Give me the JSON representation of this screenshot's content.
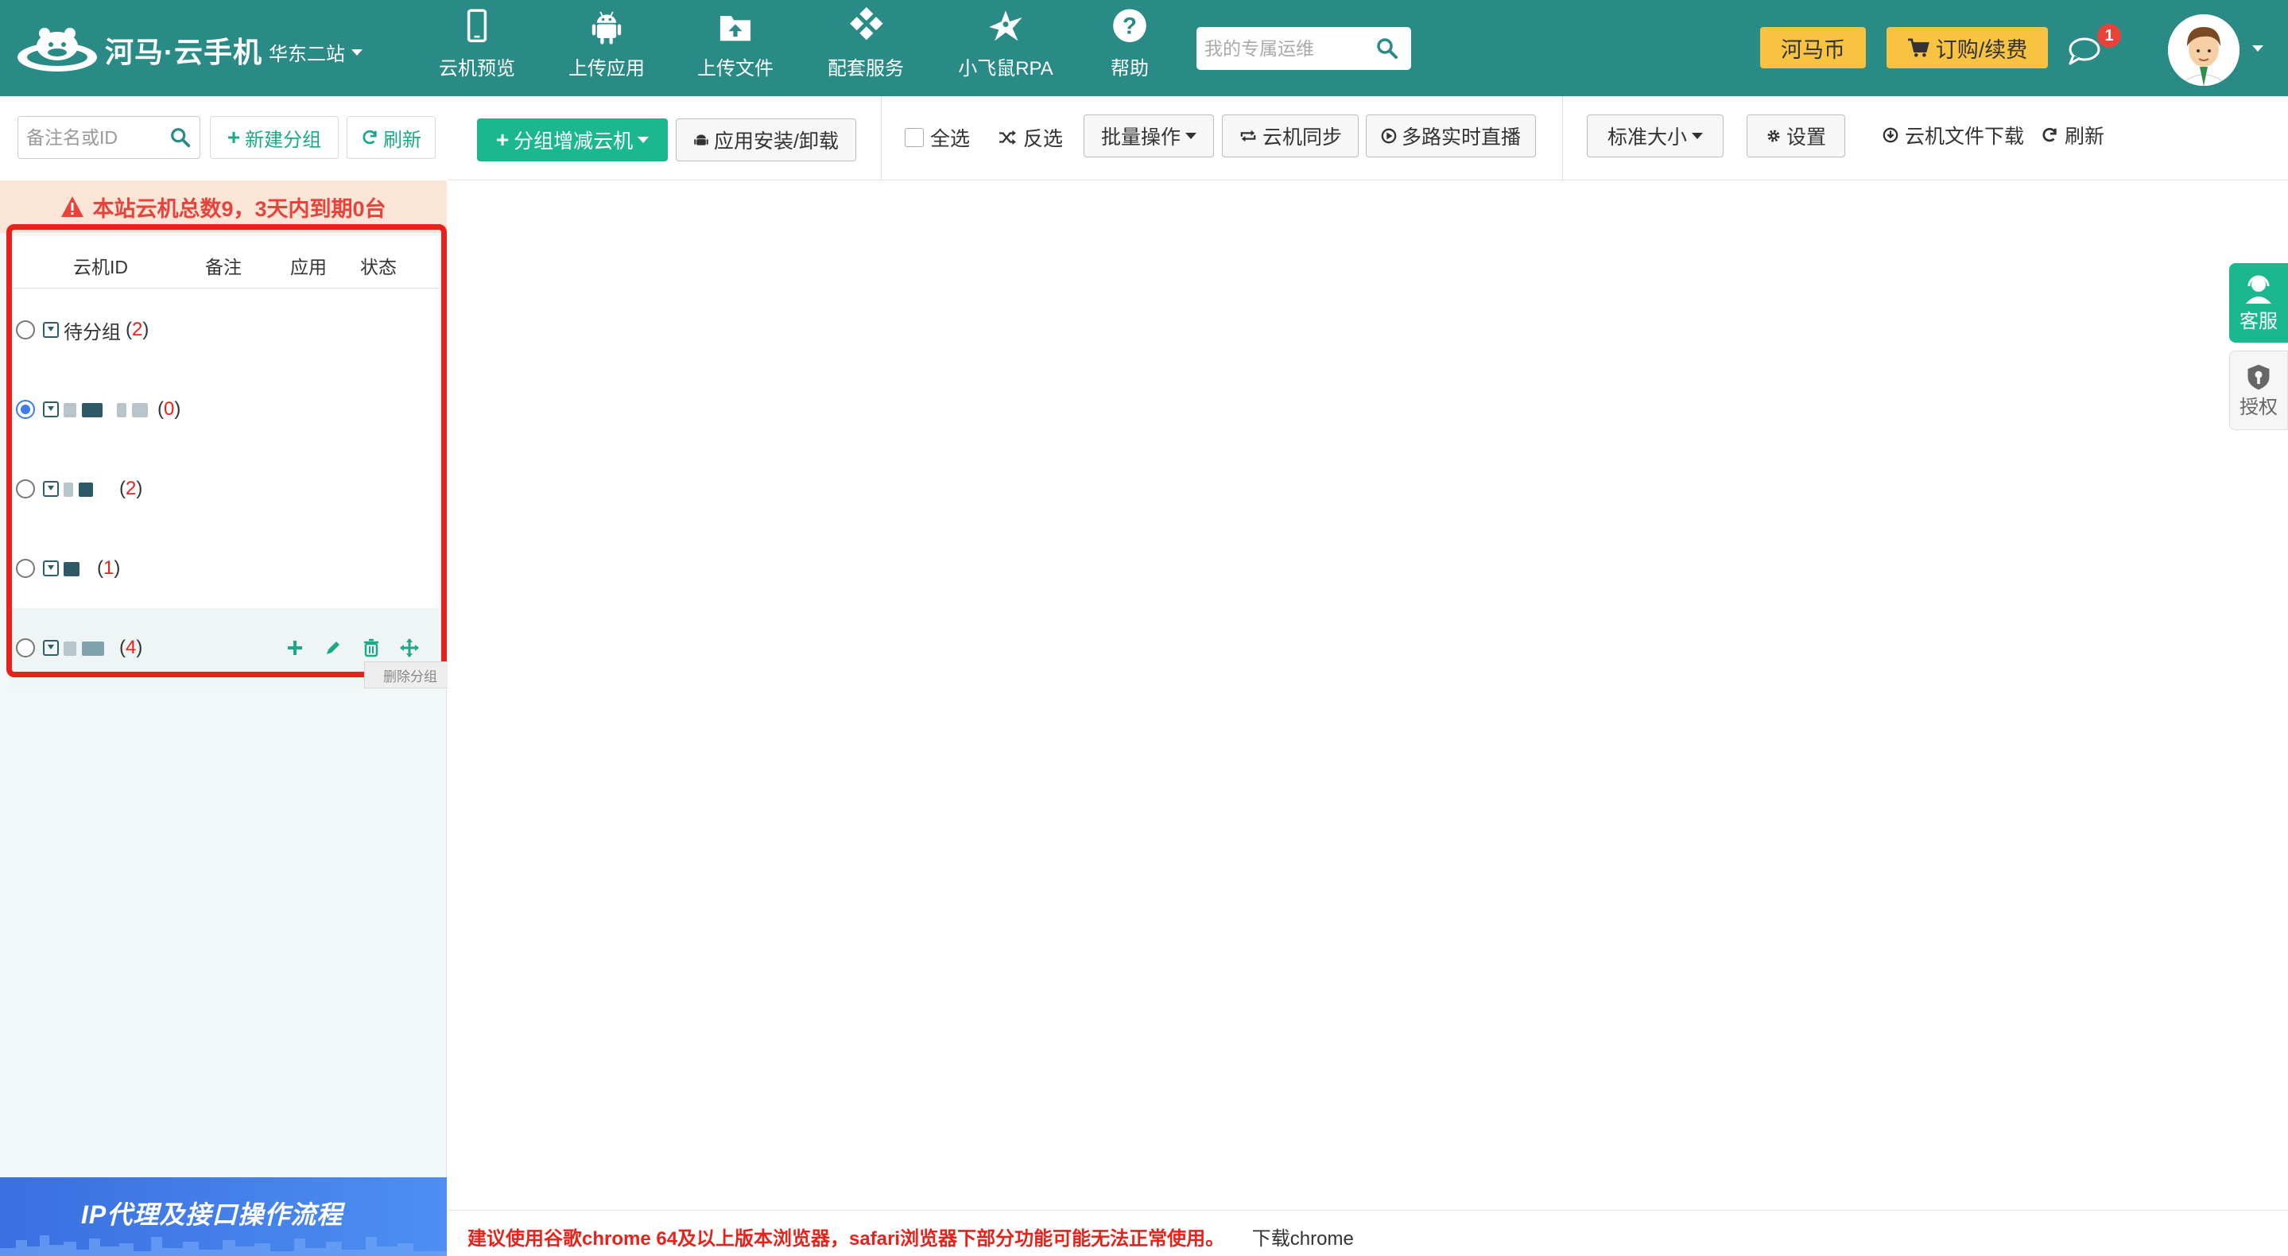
{
  "header": {
    "brand": "河马·云手机",
    "station": "华东二站",
    "nav": [
      {
        "label": "云机预览",
        "icon": "phone-icon"
      },
      {
        "label": "上传应用",
        "icon": "android-icon"
      },
      {
        "label": "上传文件",
        "icon": "upload-folder-icon"
      },
      {
        "label": "配套服务",
        "icon": "diamond-grid-icon"
      },
      {
        "label": "小飞鼠RPA",
        "icon": "flying-squirrel-icon"
      },
      {
        "label": "帮助",
        "icon": "help-icon"
      }
    ],
    "search_placeholder": "我的专属运维",
    "coins_label": "河马币",
    "order_label": "订购/续费",
    "message_badge": "1"
  },
  "sidebar": {
    "search_placeholder": "备注名或ID",
    "new_group_label": "新建分组",
    "refresh_label": "刷新",
    "alert": "本站云机总数9，3天内到期0台",
    "columns": [
      "云机ID",
      "备注",
      "应用",
      "状态"
    ],
    "groups": [
      {
        "name": "待分组",
        "count": "2",
        "selected": false
      },
      {
        "name": "",
        "count": "0",
        "selected": true
      },
      {
        "name": "",
        "count": "2",
        "selected": false
      },
      {
        "name": "",
        "count": "1",
        "selected": false
      },
      {
        "name": "",
        "count": "4",
        "selected": false
      }
    ],
    "tooltip": "删除分组",
    "banner": "IP代理及接口操作流程"
  },
  "toolbar": {
    "group_add_label": "分组增减云机",
    "app_install_label": "应用安装/卸载",
    "select_all_label": "全选",
    "invert_label": "反选",
    "batch_label": "批量操作",
    "sync_label": "云机同步",
    "live_label": "多路实时直播",
    "size_label": "标准大小",
    "settings_label": "设置",
    "download_label": "云机文件下载",
    "refresh_label": "刷新"
  },
  "float": {
    "service_label": "客服",
    "auth_label": "授权"
  },
  "footer": {
    "warning": "建议使用谷歌chrome 64及以上版本浏览器，safari浏览器下部分功能可能无法正常使用。",
    "download_link": "下载chrome"
  }
}
